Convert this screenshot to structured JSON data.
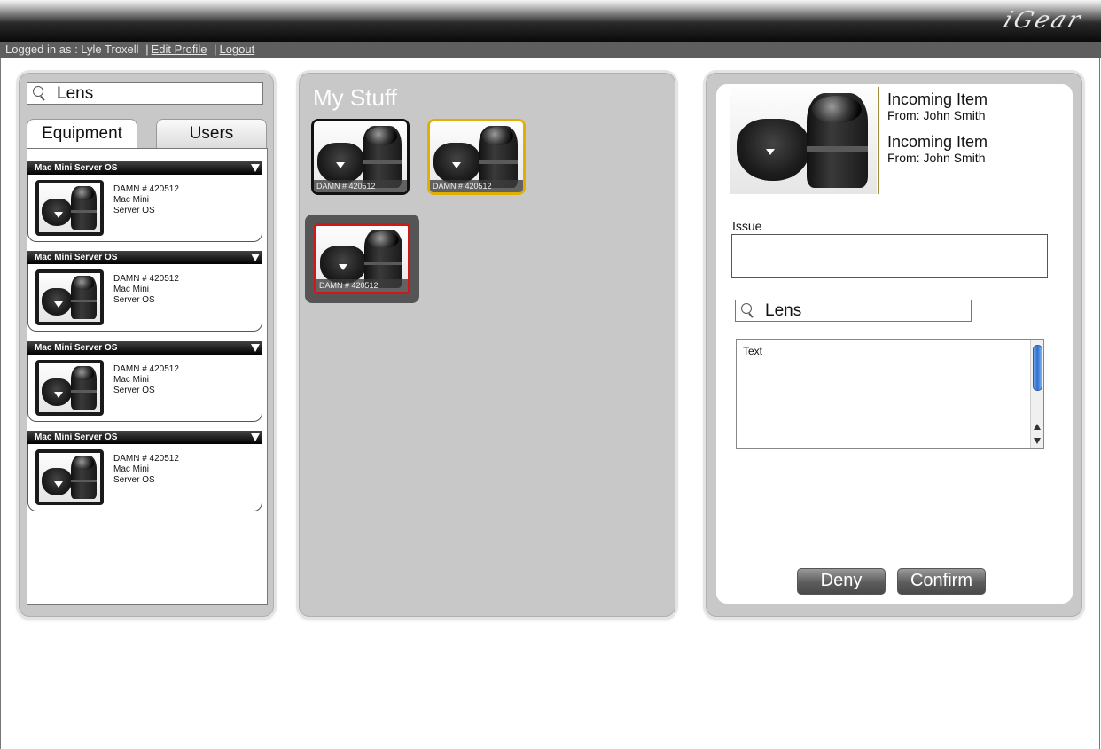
{
  "header": {
    "logo_text": "iGear",
    "logged_in_label": "Logged in as : Lyle Troxell",
    "sep1": "|",
    "edit_profile": "Edit Profile",
    "sep2": "|",
    "logout": "Logout"
  },
  "left": {
    "search_value": "Lens",
    "tabs": [
      "Equipment",
      "Users"
    ],
    "items": [
      {
        "header": "Mac Mini Server OS",
        "id": "DAMN # 420512",
        "line2": "Mac Mini",
        "line3": "Server OS"
      },
      {
        "header": "Mac Mini Server OS",
        "id": "DAMN # 420512",
        "line2": "Mac Mini",
        "line3": "Server OS"
      },
      {
        "header": "Mac Mini Server OS",
        "id": "DAMN # 420512",
        "line2": "Mac Mini",
        "line3": "Server OS"
      },
      {
        "header": "Mac Mini Server OS",
        "id": "DAMN # 420512",
        "line2": "Mac Mini",
        "line3": "Server OS"
      }
    ]
  },
  "middle": {
    "title": "My Stuff",
    "tiles": [
      {
        "caption": "DAMN # 420512",
        "border_color": "#111111"
      },
      {
        "caption": "DAMN # 420512",
        "border_color": "#e0b000"
      },
      {
        "caption": "DAMN # 420512",
        "border_color": "#d01818"
      }
    ]
  },
  "right": {
    "incoming": [
      {
        "title": "Incoming Item",
        "from": "From: John Smith"
      },
      {
        "title": "Incoming Item",
        "from": "From: John Smith"
      }
    ],
    "issue_label": "Issue",
    "search_value": "Lens",
    "textarea_text": "Text",
    "deny_label": "Deny",
    "confirm_label": "Confirm"
  }
}
